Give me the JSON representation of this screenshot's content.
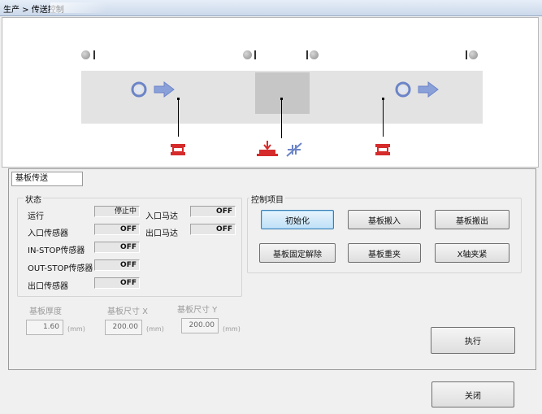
{
  "window": {
    "title": "生产 > 传送控制"
  },
  "tab": {
    "label": "基板传送"
  },
  "status": {
    "group_label": "状态",
    "running_label": "运行",
    "running_value": "停止中",
    "entry_sensor_label": "入口传感器",
    "entry_sensor_value": "OFF",
    "in_stop_sensor_label": "IN-STOP传感器",
    "in_stop_sensor_value": "OFF",
    "out_stop_sensor_label": "OUT-STOP传感器",
    "out_stop_sensor_value": "OFF",
    "exit_sensor_label": "出口传感器",
    "exit_sensor_value": "OFF",
    "entry_motor_label": "入口马达",
    "entry_motor_value": "OFF",
    "exit_motor_label": "出口马达",
    "exit_motor_value": "OFF"
  },
  "control": {
    "group_label": "控制项目",
    "buttons": {
      "initialize": "初始化",
      "board_in": "基板搬入",
      "board_out": "基板搬出",
      "board_fix_release": "基板固定解除",
      "board_reclamp": "基板重夹",
      "x_clamp": "X轴夹紧"
    }
  },
  "params": {
    "thickness_label": "基板厚度",
    "thickness_value": "1.60",
    "size_x_label": "基板尺寸 X",
    "size_x_value": "200.00",
    "size_y_label": "基板尺寸 Y",
    "size_y_value": "200.00",
    "unit": "(mm)"
  },
  "actions": {
    "execute": "执行",
    "close": "关闭"
  },
  "icons": {
    "flow_in": "rotate-arrow-right-icon",
    "flow_out": "rotate-arrow-right-icon",
    "entry_sensor": "sensor-clamp-icon",
    "stop_sensor": "board-stop-icon",
    "no_sensor": "sensor-disabled-icon",
    "exit_sensor": "sensor-clamp-icon"
  },
  "colors": {
    "sensor_red": "#d52b2b",
    "flow_blue": "#6c85c8",
    "default_button": "#bfe0f7"
  }
}
